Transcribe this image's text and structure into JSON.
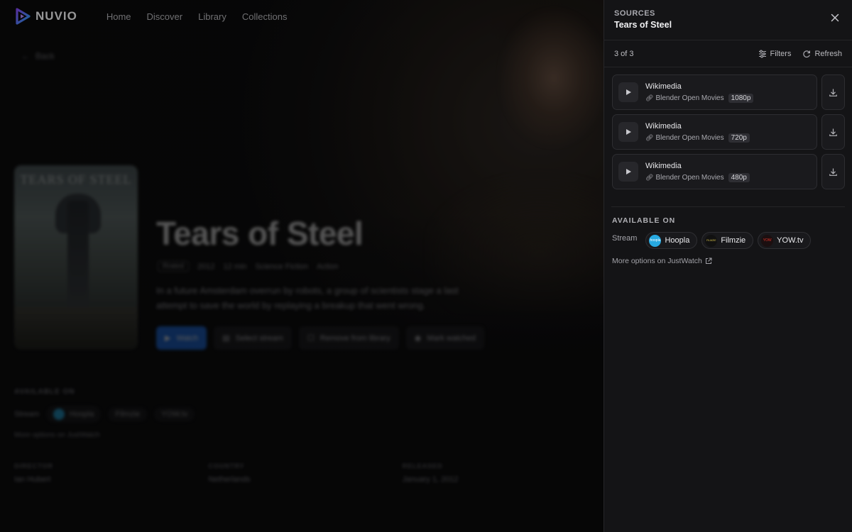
{
  "app": {
    "name": "NUVIO"
  },
  "nav": {
    "items": [
      "Home",
      "Discover",
      "Library",
      "Collections"
    ]
  },
  "background": {
    "back_label": "Back",
    "poster_title": "TEARS OF STEEL",
    "title": "Tears of Steel",
    "meta": {
      "rating": "Rrated",
      "year": "2012",
      "runtime": "12 min",
      "genres": [
        "Science Fiction",
        "Action"
      ]
    },
    "synopsis": "In a future Amsterdam overrun by robots, a group of scientists stage a last attempt to save the world by replaying a breakup that went wrong.",
    "actions": [
      "Watch",
      "Select stream",
      "Remove from library",
      "Mark watched"
    ],
    "available_on": {
      "title": "AVAILABLE ON",
      "stream_label": "Stream",
      "providers": [
        "Hoopla",
        "Filmzie",
        "YOW.tv"
      ],
      "more": "More options on JustWatch"
    },
    "facts": [
      {
        "label": "DIRECTOR",
        "value": "Ian Hubert"
      },
      {
        "label": "COUNTRY",
        "value": "Netherlands"
      },
      {
        "label": "RELEASED",
        "value": "January 1, 2012"
      }
    ]
  },
  "panel": {
    "kicker": "SOURCES",
    "title": "Tears of Steel",
    "count": "3 of 3",
    "filters_label": "Filters",
    "refresh_label": "Refresh",
    "sources": [
      {
        "name": "Wikimedia",
        "provider": "Blender Open Movies",
        "quality": "1080p"
      },
      {
        "name": "Wikimedia",
        "provider": "Blender Open Movies",
        "quality": "720p"
      },
      {
        "name": "Wikimedia",
        "provider": "Blender Open Movies",
        "quality": "480p"
      }
    ],
    "available_on": {
      "title": "AVAILABLE ON",
      "stream_label": "Stream",
      "providers": [
        {
          "name": "Hoopla",
          "logo_text": "hoopla",
          "color": "#27a9e1"
        },
        {
          "name": "Filmzie",
          "logo_text": "FILMZIE",
          "color": "#111111"
        },
        {
          "name": "YOW.tv",
          "logo_text": "YOW",
          "color": "#1b0f10"
        }
      ],
      "more": "More options on JustWatch"
    }
  },
  "colors": {
    "accent": "#1f6fe5",
    "logo_gradient": [
      "#7b4dff",
      "#2aa7ff"
    ]
  }
}
